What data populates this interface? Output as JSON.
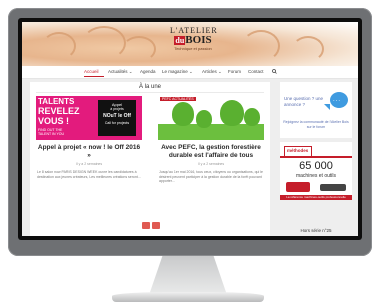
{
  "site": {
    "logo_line1": "L'ATELIER",
    "logo_line2": "BOIS",
    "logo_mark": "du",
    "logo_line3": "Technique et passion"
  },
  "nav": {
    "items": [
      "Accueil",
      "Actualités ⌄",
      "Agenda",
      "Le magazine ⌄",
      "Articles ⌄",
      "Forum",
      "Contact"
    ],
    "search_icon": "search-icon"
  },
  "main": {
    "section_title": "À la une",
    "card1": {
      "image": {
        "talents": "TALENTS",
        "revelez": "REVELEZ",
        "vous": "VOUS !",
        "small": "FIND OUT THE TALENT IN YOU",
        "box_l1": "Appel",
        "box_l2": "à projets",
        "box_l3": "NOuT le Off",
        "box_l4": "Call for projects"
      },
      "title": "Appel à projet « now ! le Off 2016 »",
      "meta": "Il y a 2 semaines",
      "text": "Le 8 salon now PARIS DESIGN WEEK ouvre les candidatures à destination aux jeunes créateurs, Les meilleures créations seront..."
    },
    "card2": {
      "tag": "PEFC ACTUALITÉS",
      "title": "Avec PEFC, la gestion forestière durable est l'affaire de tous",
      "meta": "Il y a 2 semaines",
      "text": "Jusqu'au 1er mai 2016, tous ceux, citoyens ou organisations, qui le désirent peuvent participer à la gestion durable de la forêt pouvant apporter..."
    }
  },
  "sidebar": {
    "question_text": "Une question ? une annonce ?",
    "bubble_dots": "...",
    "question_link": "Rejoignez la communauté de l'Atelier Bois sur le forum",
    "ad": {
      "brand": "méthodes",
      "number": "65 000",
      "subtitle": "machines et outils",
      "footer": "La référence machines-outils professionnelle"
    },
    "issue_label": "Hors série n°25"
  },
  "colors": {
    "accent_red": "#c51d2a",
    "pink": "#e31b7d",
    "green": "#6cbf3e",
    "blue": "#3f9be0"
  }
}
